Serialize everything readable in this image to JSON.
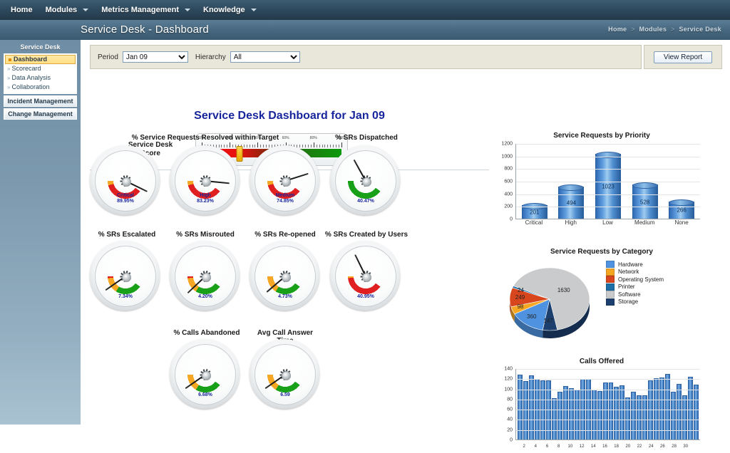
{
  "topnav": {
    "items": [
      {
        "label": "Home",
        "has_caret": false
      },
      {
        "label": "Modules",
        "has_caret": true
      },
      {
        "label": "Metrics Management",
        "has_caret": true
      },
      {
        "label": "Knowledge",
        "has_caret": true
      }
    ]
  },
  "header": {
    "page_title": "Service Desk - Dashboard",
    "breadcrumb": [
      "Home",
      "Modules",
      "Service Desk"
    ],
    "breadcrumb_separator": ">"
  },
  "sidebar": {
    "group_title": "Service Desk",
    "items": [
      {
        "label": "Dashboard",
        "active": true
      },
      {
        "label": "Scorecard",
        "active": false
      },
      {
        "label": "Data Analysis",
        "active": false
      },
      {
        "label": "Collaboration",
        "active": false
      }
    ],
    "bars": [
      {
        "label": "Incident Management"
      },
      {
        "label": "Change Management"
      }
    ]
  },
  "filters": {
    "period_label": "Period",
    "period_value": "Jan 09",
    "period_options": [
      "Jan 09"
    ],
    "hierarchy_label": "Hierarchy",
    "hierarchy_value": "All",
    "hierarchy_options": [
      "All"
    ],
    "view_report_label": "View Report"
  },
  "dashboard": {
    "title": "Service Desk Dashboard for Jan 09",
    "score": {
      "label_line1": "Service Desk",
      "label_line2": "Score",
      "value_pct": 27,
      "tick_labels": [
        "0%",
        "20%",
        "40%",
        "60%",
        "80%",
        "100%"
      ]
    },
    "sections": [
      {
        "title": "% Service Requests Resolved within Target"
      },
      {
        "title": "% SRs Dispatched"
      },
      {
        "title": "% SRs Escalated"
      },
      {
        "title": "% SRs Misrouted"
      },
      {
        "title": "% SRs Re-opened"
      },
      {
        "title": "% SRs Created by Users"
      },
      {
        "title": "% Calls Abandoned"
      },
      {
        "title": "Avg Call Answer Time"
      }
    ],
    "gauges": [
      {
        "name": "Critical",
        "value": "89.95%",
        "needle_pct": 90,
        "bands": "redToGreen"
      },
      {
        "name": "High",
        "value": "83.23%",
        "needle_pct": 83,
        "bands": "redToGreen"
      },
      {
        "name": "Medium",
        "value": "74.85%",
        "needle_pct": 75,
        "bands": "redToGreen"
      },
      {
        "name": "",
        "value": "40.47%",
        "needle_pct": 40,
        "bands": "greenToRed"
      },
      {
        "name": "",
        "value": "7.34%",
        "needle_pct": 7,
        "bands": "greenMidRed"
      },
      {
        "name": "",
        "value": "4.20%",
        "needle_pct": 4,
        "bands": "greenMidRed"
      },
      {
        "name": "",
        "value": "4.73%",
        "needle_pct": 5,
        "bands": "greenOrangeRed"
      },
      {
        "name": "",
        "value": "40.95%",
        "needle_pct": 41,
        "bands": "redOrangeGreen"
      },
      {
        "name": "",
        "value": "6.68%",
        "needle_pct": 7,
        "bands": "greenOrangeRed"
      },
      {
        "name": "",
        "value": "6.59",
        "needle_pct": 7,
        "bands": "greenOrangeRed"
      }
    ]
  },
  "chart_data": [
    {
      "type": "bar",
      "title": "Service Requests by Priority",
      "categories": [
        "Critical",
        "High",
        "Low",
        "Medium",
        "None"
      ],
      "values": [
        201,
        494,
        1023,
        528,
        266
      ],
      "value_labels": [
        "201",
        "494",
        "1023",
        "528",
        "266"
      ],
      "xlabel": "",
      "ylabel": "",
      "ylim": [
        0,
        1200
      ],
      "yticks": [
        0,
        200,
        400,
        600,
        800,
        1000,
        1200
      ],
      "grid": true,
      "legend": "none",
      "bar_color": "#4f8ed0"
    },
    {
      "type": "pie",
      "title": "Service Requests by Category",
      "categories": [
        "Hardware",
        "Network",
        "Operating System",
        "Printer",
        "Software",
        "Storage"
      ],
      "values": [
        360,
        98,
        249,
        24,
        1630,
        147
      ],
      "value_labels": [
        "360",
        "98",
        "249",
        "24",
        "1630",
        "147"
      ],
      "colors": [
        "#4f93e0",
        "#f5a623",
        "#d8461e",
        "#1b6ea8",
        "#c9cbcc",
        "#1c3f6e"
      ],
      "legend": "right"
    },
    {
      "type": "bar",
      "title": "Calls Offered",
      "categories": [
        "1",
        "2",
        "3",
        "4",
        "5",
        "6",
        "7",
        "8",
        "9",
        "10",
        "11",
        "12",
        "13",
        "14",
        "15",
        "16",
        "17",
        "18",
        "19",
        "20",
        "21",
        "22",
        "23",
        "24",
        "25",
        "26",
        "27",
        "28",
        "29",
        "30",
        "31"
      ],
      "values": [
        126,
        114,
        125,
        117,
        115,
        115,
        80,
        93,
        104,
        100,
        97,
        118,
        117,
        96,
        94,
        110,
        110,
        102,
        105,
        81,
        93,
        85,
        85,
        115,
        119,
        121,
        128,
        93,
        108,
        85,
        122,
        106
      ],
      "xtick_labels": [
        "2",
        "4",
        "6",
        "8",
        "10",
        "12",
        "14",
        "16",
        "18",
        "20",
        "22",
        "24",
        "26",
        "28",
        "30"
      ],
      "xlabel": "",
      "ylabel": "",
      "ylim": [
        0,
        140
      ],
      "yticks": [
        0,
        20,
        40,
        60,
        80,
        100,
        120,
        140
      ],
      "grid": true,
      "legend": "none",
      "bar_color": "#4f8ed0"
    }
  ]
}
